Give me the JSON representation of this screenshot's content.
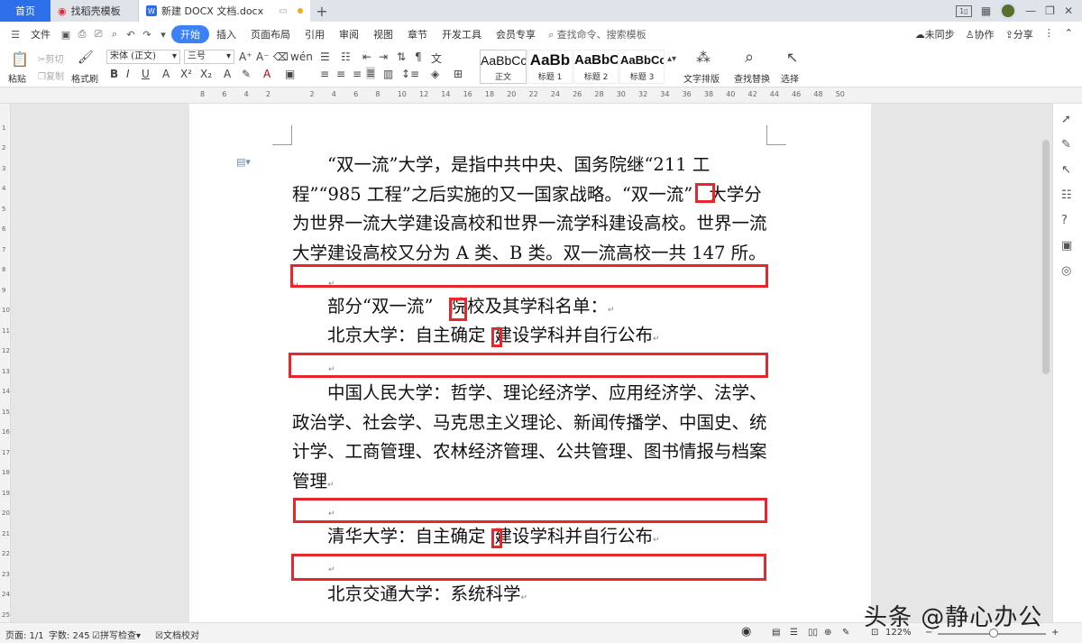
{
  "tabs": {
    "home": "首页",
    "template": "找稻壳模板",
    "document": "新建 DOCX 文档.docx"
  },
  "menu": {
    "file": "文件",
    "start": "开始",
    "insert": "插入",
    "layout": "页面布局",
    "reference": "引用",
    "review": "审阅",
    "view": "视图",
    "chapter": "章节",
    "devtools": "开发工具",
    "member": "会员专享",
    "search": "查找命令、搜索模板",
    "sync": "未同步",
    "collab": "协作",
    "share": "分享"
  },
  "ribbon": {
    "paste": "粘贴",
    "cut": "剪切",
    "copy": "复制",
    "format_painter": "格式刷",
    "font_name": "宋体 (正文)",
    "font_size": "三号",
    "styles": [
      {
        "preview": "AaBbCcDd",
        "label": "正文"
      },
      {
        "preview": "AaBb",
        "label": "标题 1"
      },
      {
        "preview": "AaBbC",
        "label": "标题 2"
      },
      {
        "preview": "AaBbCc",
        "label": "标题 3"
      }
    ],
    "text_layout": "文字排版",
    "find_replace": "查找替换",
    "select": "选择"
  },
  "ruler": {
    "marks": [
      "8",
      "6",
      "4",
      "2",
      "",
      "2",
      "4",
      "6",
      "8",
      "10",
      "12",
      "14",
      "16",
      "18",
      "20",
      "22",
      "24",
      "26",
      "28",
      "30",
      "32",
      "34",
      "36",
      "38",
      "40",
      "42",
      "44",
      "46",
      "48",
      "50"
    ]
  },
  "document": {
    "p1": "“双一流”大学，是指中共中央、国务院继“211 工程”“985 工程”之后实施的又一国家战略。“双一流”",
    "p1b": "大学分为世界一流大学建设高校和世界一流学科建设高校。世界一流大学建设高校又分为 A 类、B 类。双一流高校一共 147 所。",
    "p2a": "部分“双一流”",
    "p2b": "院校及其学科名单：",
    "p3a": "北京大学：自主确定",
    "p3b": "建设学科并自行公布",
    "p4": "中国人民大学：哲学、理论经济学、应用经济学、法学、政治学、社会学、马克思主义理论、新闻传播学、中国史、统计学、工商管理、农林经济管理、公共管理、图书情报与档案管理",
    "p5a": "清华大学：自主确定",
    "p5b": "建设学科并自行公布",
    "p6": "北京交通大学：系统科学"
  },
  "status": {
    "page": "页面: 1/1",
    "words": "字数: 245",
    "spell": "拼写检查",
    "proof": "文档校对",
    "zoom": "122%"
  },
  "watermark": "头条 @静心办公"
}
